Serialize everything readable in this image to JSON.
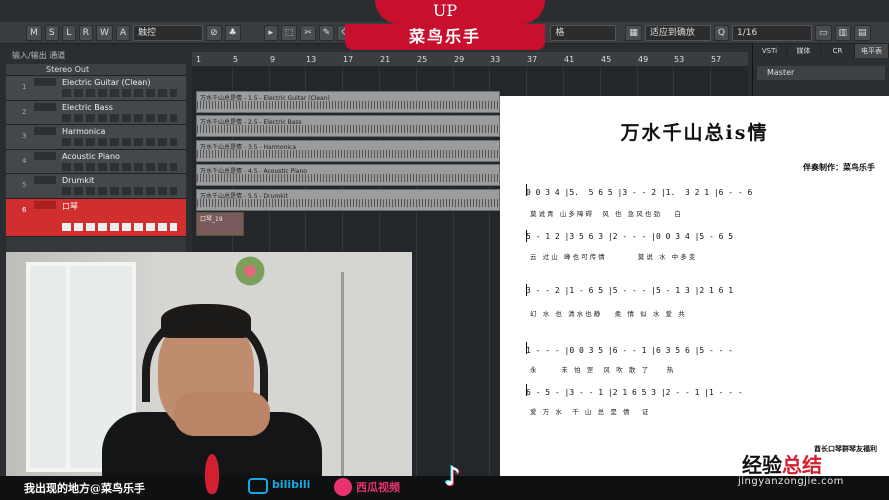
{
  "banner": {
    "up": "UP",
    "name": "菜鸟乐手"
  },
  "toolbar": {
    "buttons": [
      "M",
      "S",
      "L",
      "R",
      "W",
      "A"
    ],
    "touch_label": "触控",
    "snap_label": "适应到确放",
    "grid_label": "1/16",
    "tail_label": "格"
  },
  "tracks_panel": {
    "header": "输入/输出 通道",
    "stereo_out": "Stereo Out",
    "tracks": [
      {
        "num": "1",
        "name": "Electric Guitar (Clean)"
      },
      {
        "num": "2",
        "name": "Electric Bass"
      },
      {
        "num": "3",
        "name": "Harmonica"
      },
      {
        "num": "4",
        "name": "Acoustic Piano"
      },
      {
        "num": "5",
        "name": "Drumkit"
      },
      {
        "num": "6",
        "name": "口琴"
      }
    ]
  },
  "ruler": {
    "bars": [
      "1",
      "5",
      "9",
      "13",
      "17",
      "21",
      "25",
      "29",
      "33",
      "37",
      "41",
      "45",
      "49",
      "53",
      "57"
    ]
  },
  "clips": [
    "万水千山总是情 - 1.5 - Electric Guitar (Clean)",
    "万水千山总是情 - 2.5 - Electric Bass",
    "万水千山总是情 - 3.5 - Harmonica",
    "万水千山总是情 - 4.5 - Acoustic Piano",
    "万水千山总是情 - 5.5 - Drumkit",
    "口琴_19"
  ],
  "right_panel": {
    "tabs": [
      "VSTi",
      "媒体",
      "CR",
      "电平表"
    ],
    "master": "Master"
  },
  "sheet": {
    "title": "万水千山总is情",
    "arranger": "伴奏制作：菜鸟乐手",
    "rows": [
      {
        "notes": "0 0 3 4 |5.  5 6 5 |3 - - 2 |1.  3 2 1 |6 - - 6",
        "lyrics": "莫 说 青   山 多 障 碍     风   也   急 风 也 劲       白"
      },
      {
        "notes": "5 - 1 2 |3 5 6 3 |2 - - - |0 0 3 4 |5 - 6 5",
        "lyrics": "云   过 山   峰 也 可 传 情                莫 说   水   中 多 变"
      },
      {
        "notes": "3 - - 2 |1 - 6 5 |5 - - - |5 - 1 3 |2 1 6 1",
        "lyrics": "幻   水   也   清 水 也 静       柔   情   似   水   爱   共"
      },
      {
        "notes": "1 - - - |0 0 3 5 |6 - - 1 |6 3 5 6 |5 - - -",
        "lyrics": "永            未   怕   罡     风   吹   散   了         热"
      },
      {
        "notes": "6 - 5 - |3 - - 1 |2 1 6 5 3 |2 - - 1 |1 - - -",
        "lyrics": "爱   万   水     千   山   总   是   情      证"
      }
    ],
    "footer": "酋长口琴群琴友福利"
  },
  "bottom": {
    "caption": "我出现的地方@菜鸟乐手",
    "bilibili": "bilibili",
    "xigua": "西瓜视频",
    "douyin_icon": "♪",
    "watermark_cn_1": "经验",
    "watermark_cn_2": "总结",
    "watermark_url": "jingyanzongjie.com"
  }
}
